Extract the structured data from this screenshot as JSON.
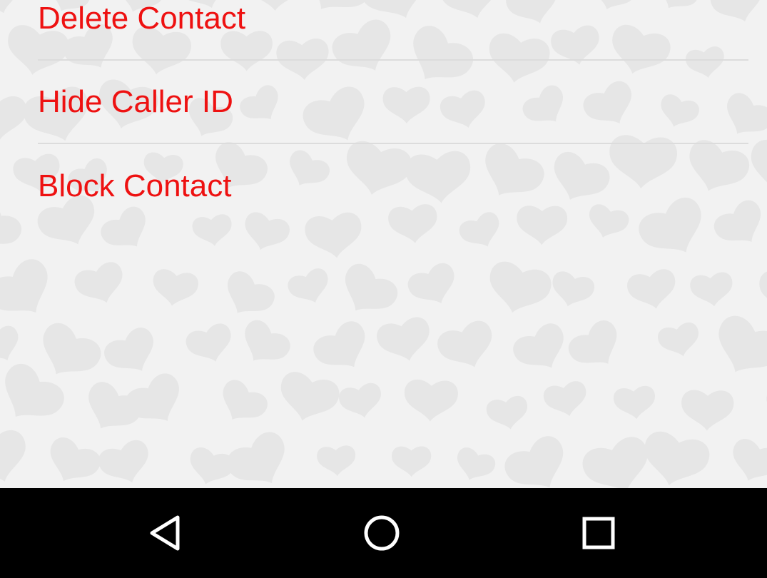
{
  "menu": {
    "items": [
      {
        "label": "Delete Contact"
      },
      {
        "label": "Hide Caller ID"
      },
      {
        "label": "Block Contact"
      }
    ]
  },
  "theme": {
    "label_color": "#ee1111",
    "background": "#f2f2f2",
    "heart_color": "#e6e6e6",
    "divider_color": "#dcdcdc",
    "navbar_color": "#000000"
  },
  "navbar": {
    "buttons": [
      {
        "icon": "back-triangle-icon"
      },
      {
        "icon": "home-circle-icon"
      },
      {
        "icon": "recents-square-icon"
      }
    ]
  }
}
